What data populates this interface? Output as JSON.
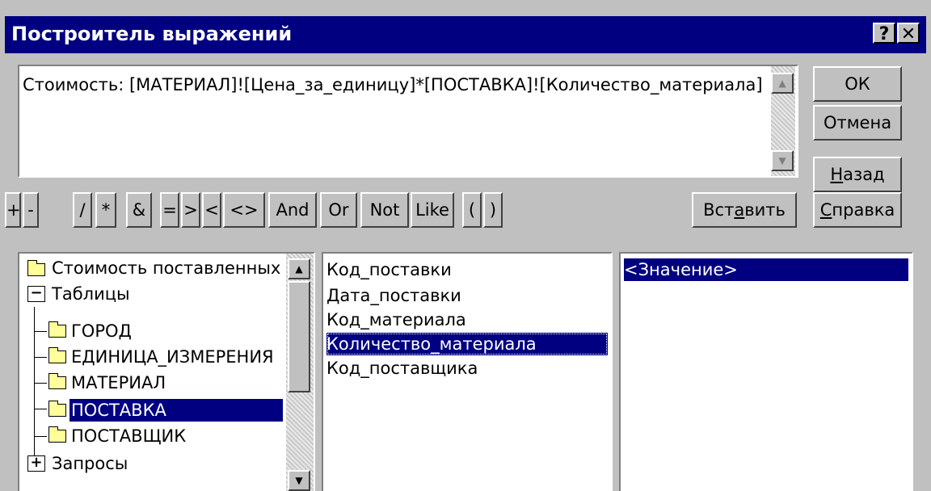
{
  "window": {
    "title": "Построитель выражений",
    "help_btn": "?",
    "close_btn": "✕"
  },
  "expression": {
    "text": "Стоимость: [МАТЕРИАЛ]![Цена_за_единицу]*[ПОСТАВКА]![Количество_материала]"
  },
  "buttons": {
    "ok": "ОК",
    "cancel": "Отмена",
    "back_pre": "",
    "back_u": "Н",
    "back_post": "азад",
    "help_pre": "",
    "help_u": "С",
    "help_post": "правка",
    "insert_pre": "Вст",
    "insert_u": "а",
    "insert_post": "вить"
  },
  "operators": [
    "+",
    "-",
    "/",
    "*",
    "&",
    "=",
    ">",
    "<",
    "<>",
    "And",
    "Or",
    "Not",
    "Like",
    "(",
    ")"
  ],
  "tree": {
    "items": [
      {
        "label": "Стоимость поставленных",
        "icon": "folder-icon"
      },
      {
        "label": "Таблицы",
        "icon": "collapse-icon"
      },
      {
        "label": "ГОРОД",
        "icon": "folder-icon"
      },
      {
        "label": "ЕДИНИЦА_ИЗМЕРЕНИЯ",
        "icon": "folder-icon"
      },
      {
        "label": "МАТЕРИАЛ",
        "icon": "folder-icon"
      },
      {
        "label": "ПОСТАВКА",
        "icon": "open-folder-icon"
      },
      {
        "label": "ПОСТАВЩИК",
        "icon": "folder-icon"
      },
      {
        "label": "Запросы",
        "icon": "expand-icon"
      }
    ]
  },
  "fields": {
    "items": [
      "Код_поставки",
      "Дата_поставки",
      "Код_материала",
      "Количество_материала",
      "Код_поставщика"
    ]
  },
  "values": {
    "items": [
      "<Значение>"
    ]
  },
  "colors": {
    "selection": "#000080",
    "face": "#c0c0c0"
  }
}
